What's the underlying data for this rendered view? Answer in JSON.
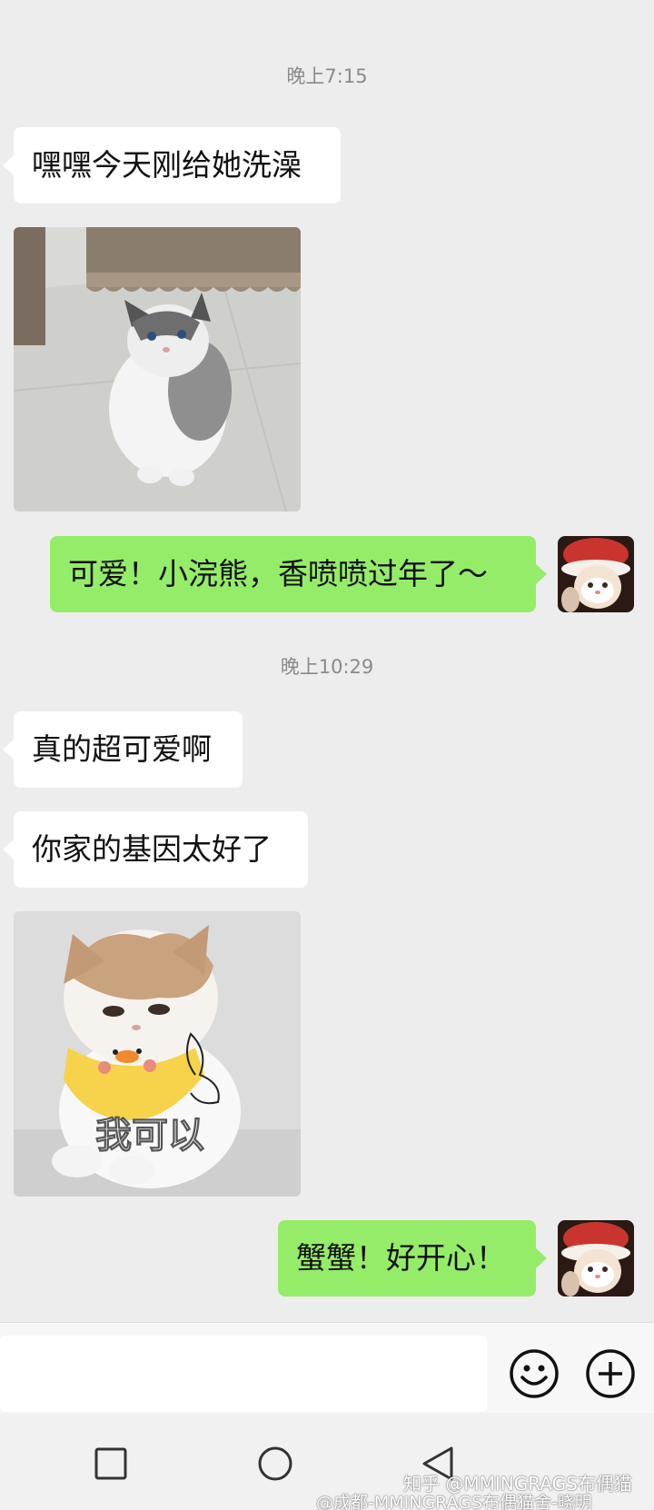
{
  "messages": {
    "time1": "晚上7:15",
    "msg1": "嘿嘿今天刚给她洗澡",
    "reply1": "可爱！小浣熊，香喷喷过年了～",
    "time2": "晚上10:29",
    "msg2": "真的超可爱啊",
    "msg3": "你家的基因太好了",
    "sticker_caption": "我可以",
    "reply2": "蟹蟹！好开心！"
  },
  "input": {
    "placeholder": "",
    "emoji_icon": "smiley-face-icon",
    "plus_icon": "plus-circle-icon"
  },
  "navbar": {
    "icons": [
      "recent-apps-square-icon",
      "home-circle-icon",
      "back-triangle-icon"
    ]
  },
  "watermarks": {
    "zhihu": "知乎 @MMINGRAGS布偶猫",
    "weibo": "@成都-MMINGRAGS布偶猫舍-晓明"
  },
  "colors": {
    "background": "#ededed",
    "bubble_sent": "#95ec69",
    "bubble_received": "#ffffff"
  }
}
